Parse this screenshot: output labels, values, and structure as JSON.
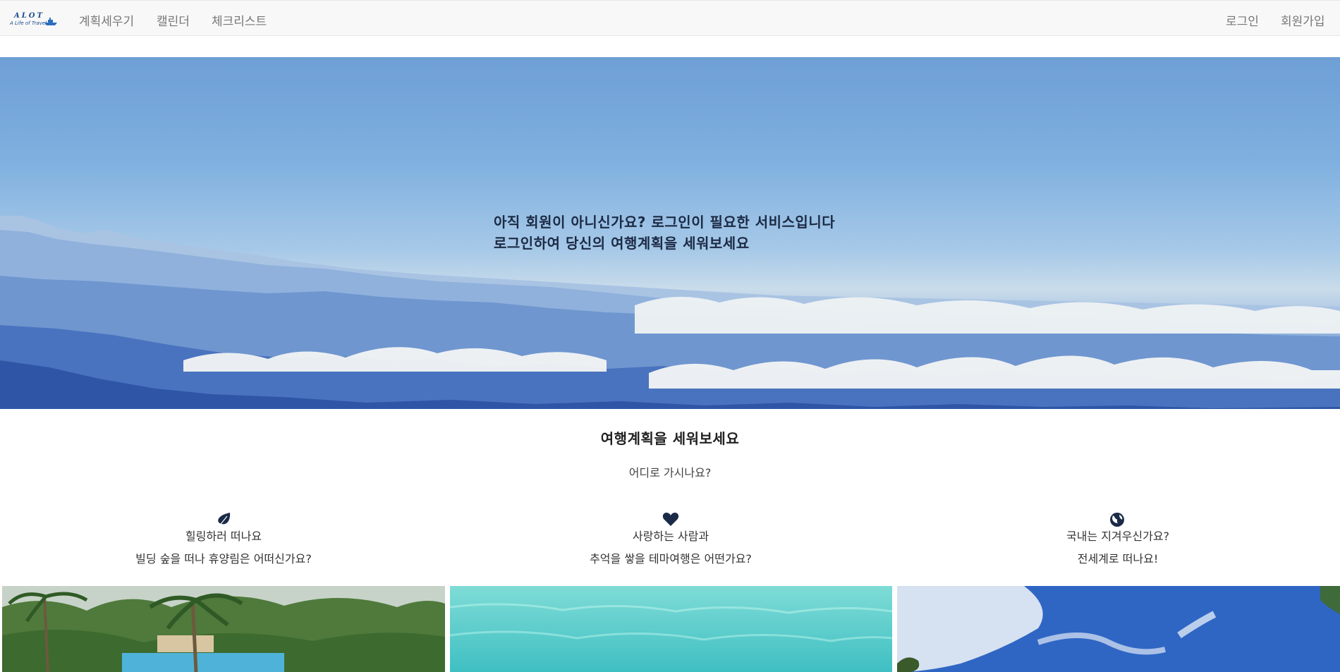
{
  "brand": {
    "logo_top": "ALOT",
    "logo_bottom": "A Life of Travel"
  },
  "nav": {
    "left": [
      "계획세우기",
      "캘린더",
      "체크리스트"
    ],
    "right": [
      "로그인",
      "회원가입"
    ]
  },
  "hero": {
    "line1": "아직 회원이 아니신가요? 로그인이 필요한 서비스입니다",
    "line2": "로그인하여 당신의 여행계획을 세워보세요"
  },
  "section": {
    "title": "여행계획을 세워보세요",
    "subtitle": "어디로 가시나요?"
  },
  "features": [
    {
      "icon": "leaf-icon",
      "line1": "힐링하러 떠나요",
      "line2": "빌딩 숲을 떠나 휴양림은 어떠신가요?"
    },
    {
      "icon": "heart-icon",
      "line1": "사랑하는 사람과",
      "line2": "추억을 쌓을 테마여행은 어떤가요?"
    },
    {
      "icon": "globe-icon",
      "line1": "국내는 지겨우신가요?",
      "line2": "전세계로 떠나요!"
    }
  ],
  "colors": {
    "navbar_bg": "#f8f8f8",
    "icon_navy": "#1b2a47",
    "hero_text": "#1c2a44"
  }
}
